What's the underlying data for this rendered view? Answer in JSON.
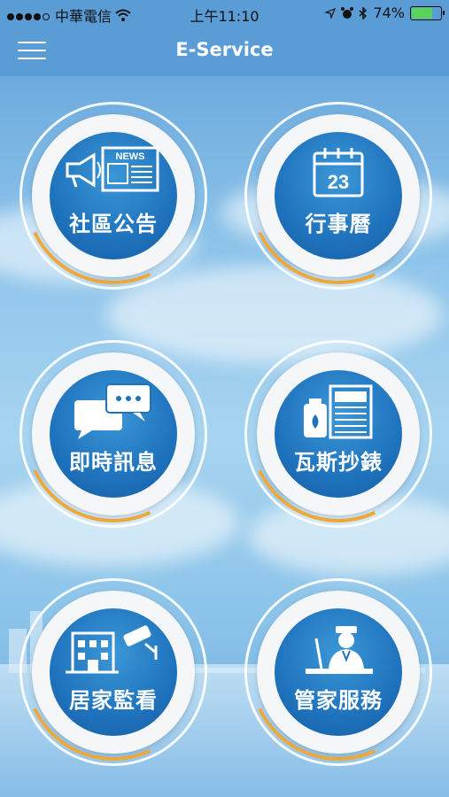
{
  "status_bar": {
    "carrier": "中華電信",
    "time": "上午11:10",
    "battery": "74%",
    "battery_level": 0.74
  },
  "nav": {
    "title": "E-Service",
    "menu_icon": "hamburger-menu-icon"
  },
  "tiles": [
    {
      "label": "社區公告",
      "icon": "megaphone-news-icon",
      "news_text": "NEWS"
    },
    {
      "label": "行事曆",
      "icon": "calendar-icon",
      "day": "23"
    },
    {
      "label": "即時訊息",
      "icon": "chat-bubbles-icon"
    },
    {
      "label": "瓦斯抄錶",
      "icon": "gas-meter-icon"
    },
    {
      "label": "居家監看",
      "icon": "security-camera-icon"
    },
    {
      "label": "管家服務",
      "icon": "concierge-icon"
    }
  ],
  "colors": {
    "nav_bg": "#5a9cd6",
    "disc_blue": "#1f73bd",
    "accent_orange": "#f1a93a",
    "battery_green": "#5ad35a"
  }
}
